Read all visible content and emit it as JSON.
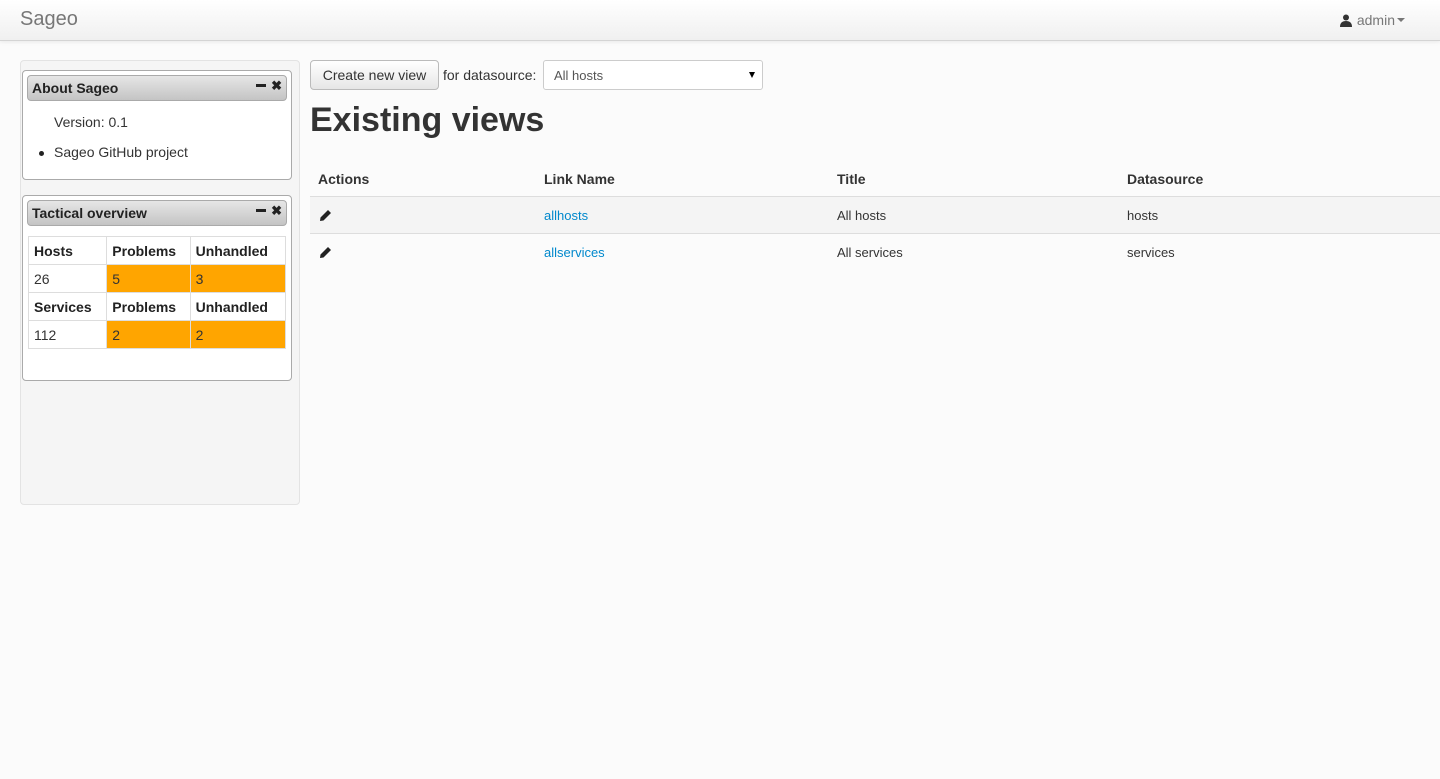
{
  "navbar": {
    "brand": "Sageo",
    "user": "admin",
    "user_icon": "user-icon"
  },
  "sidebar": {
    "about": {
      "title": "About Sageo",
      "version": "Version: 0.1",
      "link": "Sageo GitHub project"
    },
    "tactical": {
      "title": "Tactical overview",
      "hosts_header": [
        "Hosts",
        "Problems",
        "Unhandled"
      ],
      "hosts_values": [
        "26",
        "5",
        "3"
      ],
      "services_header": [
        "Services",
        "Problems",
        "Unhandled"
      ],
      "services_values": [
        "112",
        "2",
        "2"
      ]
    }
  },
  "toolbar": {
    "create_label": "Create new view",
    "for_label": "for datasource:",
    "datasource_selected": "All hosts"
  },
  "page_title": "Existing views",
  "table": {
    "headers": [
      "Actions",
      "Link Name",
      "Title",
      "Datasource"
    ],
    "rows": [
      {
        "link": "allhosts",
        "title": "All hosts",
        "datasource": "hosts"
      },
      {
        "link": "allservices",
        "title": "All services",
        "datasource": "services"
      }
    ]
  },
  "colors": {
    "warning": "#ffa500",
    "link": "#0088cc"
  }
}
